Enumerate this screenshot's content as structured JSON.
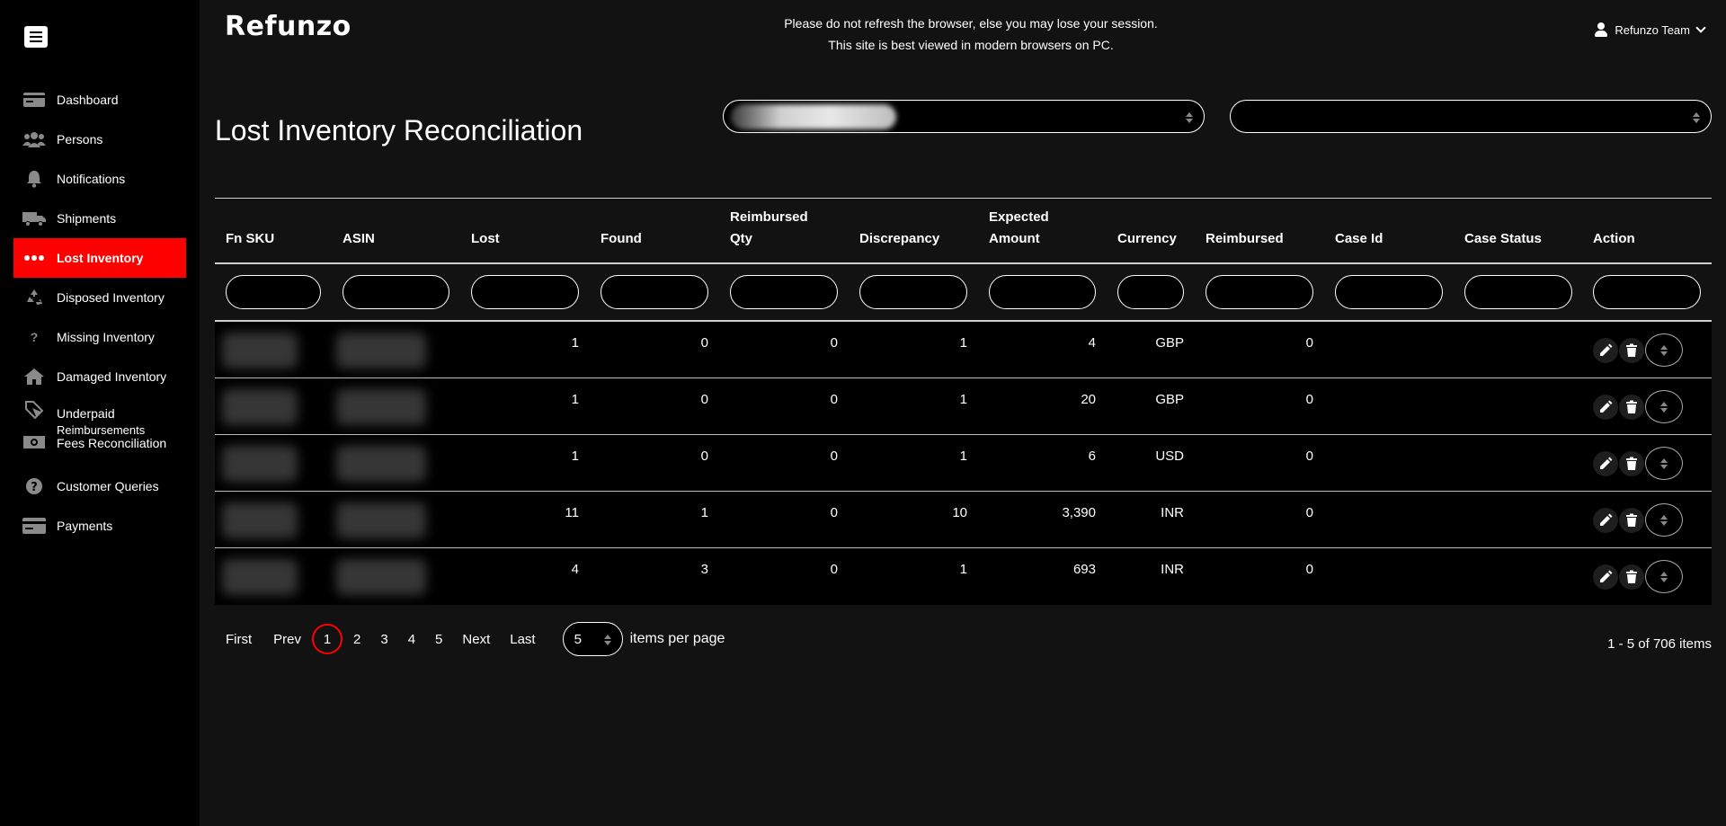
{
  "app": {
    "logo": "Refunzo"
  },
  "header": {
    "notice_line1": "Please do not refresh the browser, else you may lose your session.",
    "notice_line2": "This site is best viewed in modern browsers on PC.",
    "user_name": "Refunzo Team"
  },
  "sidebar": {
    "items": [
      {
        "label": "Dashboard",
        "icon": "id-card-icon"
      },
      {
        "label": "Persons",
        "icon": "users-icon"
      },
      {
        "label": "Notifications",
        "icon": "bell-icon"
      },
      {
        "label": "Shipments",
        "icon": "truck-icon"
      },
      {
        "label": "Lost Inventory",
        "icon": "dots-icon",
        "active": true
      },
      {
        "label": "Disposed Inventory",
        "icon": "recycle-icon"
      },
      {
        "label": "Missing Inventory",
        "icon": "question-icon"
      },
      {
        "label": "Damaged Inventory",
        "icon": "home-icon"
      },
      {
        "label": "Underpaid",
        "label2": "Reimbursements",
        "icon": "tag-icon"
      },
      {
        "label": "Fees Reconciliation",
        "icon": "money-icon"
      },
      {
        "label": "Customer Queries",
        "icon": "help-circle-icon"
      },
      {
        "label": "Payments",
        "icon": "credit-card-icon"
      }
    ]
  },
  "page": {
    "title": "Lost Inventory Reconciliation"
  },
  "table": {
    "headers": {
      "fnsku": "Fn SKU",
      "asin": "ASIN",
      "lost": "Lost",
      "found": "Found",
      "reimbursed_qty_1": "Reimbursed",
      "reimbursed_qty_2": "Qty",
      "discrepancy": "Discrepancy",
      "expected_1": "Expected",
      "expected_2": "Amount",
      "currency": "Currency",
      "reimbursed": "Reimbursed",
      "case_id": "Case Id",
      "case_status": "Case Status",
      "action": "Action"
    },
    "rows": [
      {
        "lost": "1",
        "found": "0",
        "reimbursed_qty": "0",
        "discrepancy": "1",
        "expected": "4",
        "currency": "GBP",
        "reimbursed": "0"
      },
      {
        "lost": "1",
        "found": "0",
        "reimbursed_qty": "0",
        "discrepancy": "1",
        "expected": "20",
        "currency": "GBP",
        "reimbursed": "0"
      },
      {
        "lost": "1",
        "found": "0",
        "reimbursed_qty": "0",
        "discrepancy": "1",
        "expected": "6",
        "currency": "USD",
        "reimbursed": "0"
      },
      {
        "lost": "11",
        "found": "1",
        "reimbursed_qty": "0",
        "discrepancy": "10",
        "expected": "3,390",
        "currency": "INR",
        "reimbursed": "0"
      },
      {
        "lost": "4",
        "found": "3",
        "reimbursed_qty": "0",
        "discrepancy": "1",
        "expected": "693",
        "currency": "INR",
        "reimbursed": "0"
      }
    ]
  },
  "pagination": {
    "first": "First",
    "prev": "Prev",
    "pages": [
      "1",
      "2",
      "3",
      "4",
      "5"
    ],
    "current": "1",
    "next": "Next",
    "last": "Last",
    "per_page": "5",
    "per_page_label": "items per page",
    "range": "1 - 5 of 706 items"
  }
}
